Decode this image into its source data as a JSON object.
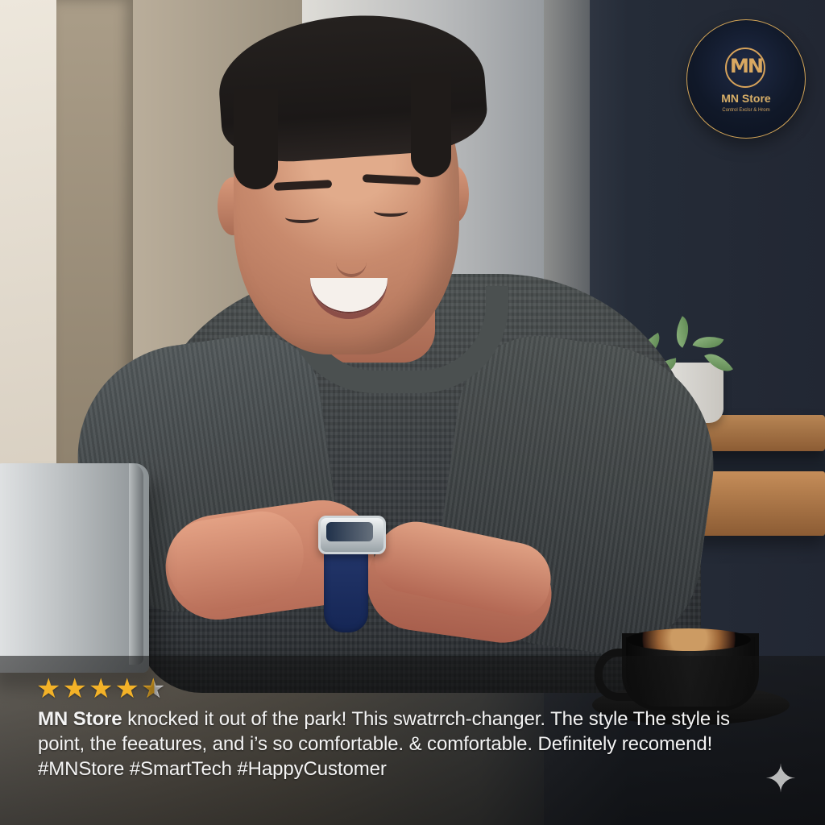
{
  "logo": {
    "letters": "MN",
    "title": "MN Store",
    "tagline": "Cоntrol Ехсlsr & Hrоm"
  },
  "review": {
    "rating": 4.5,
    "stars": [
      {
        "state": "full",
        "glyph": "★"
      },
      {
        "state": "full",
        "glyph": "★"
      },
      {
        "state": "full",
        "glyph": "★"
      },
      {
        "state": "full",
        "glyph": "★"
      },
      {
        "state": "half",
        "glyph": "★"
      }
    ],
    "brand": "MN Store",
    "text": " knocked it out of the park! This swatrrch-changer. The style The style is point, the feeatures, and i’s so comfortable. & comfortable. Definitely recomend! #MNStore #SmartTech #HappyCustomer"
  },
  "icons": {
    "sparkle": "✦"
  },
  "colors": {
    "star": "#f3b228",
    "logo_gold": "#d6a25a",
    "overlay": "#111111"
  }
}
